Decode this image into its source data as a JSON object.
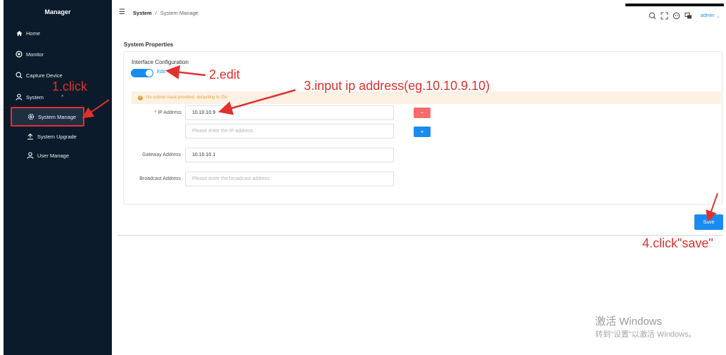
{
  "app": {
    "title": "Manager"
  },
  "sidebar": {
    "items": [
      {
        "label": "Home",
        "icon": "home-icon"
      },
      {
        "label": "Monitor",
        "icon": "monitor-icon"
      },
      {
        "label": "Capture Device",
        "icon": "search-icon"
      },
      {
        "label": "System",
        "icon": "user-icon",
        "expanded": true
      },
      {
        "label": "System Manage",
        "icon": "gear-icon",
        "active": true
      },
      {
        "label": "System Upgrade",
        "icon": "upload-icon"
      },
      {
        "label": "User Manage",
        "icon": "person-icon"
      }
    ]
  },
  "header": {
    "breadcrumb": [
      "System",
      "/",
      "System Manage"
    ],
    "user": "admin",
    "icons": [
      "search-icon",
      "fullscreen-icon",
      "theme-icon",
      "language-icon"
    ]
  },
  "main": {
    "section_title": "System Properties",
    "card_title": "Interface Configuration",
    "edit_toggle": {
      "label": "Edit",
      "on": true
    },
    "warning": "No subnet mask provided, defaulting to /24.",
    "form": {
      "ip_label": "IP Address",
      "ip_value": "10.10.10.9",
      "ip_placeholder": "Please enter the IP address",
      "remove_label": "−",
      "add_label": "+",
      "gateway_label": "Gateway Address",
      "gateway_value": "10.10.10.1",
      "broadcast_label": "Broadcast Address",
      "broadcast_placeholder": "Please enter the broadcast address"
    },
    "save_label": "Save"
  },
  "annotations": {
    "step1": "1.click",
    "step2": "2.edit",
    "step3": "3.input ip address(eg.10.10.9.10)",
    "step4": "4.click\"save\""
  },
  "watermark": {
    "line1": "激活 Windows",
    "line2": "转到\"设置\"以激活 Windows。"
  },
  "colors": {
    "sidebar_bg": "#0b1b2b",
    "accent": "#1a8bf0",
    "danger": "#f56c6c",
    "annotation": "#e0312c"
  }
}
